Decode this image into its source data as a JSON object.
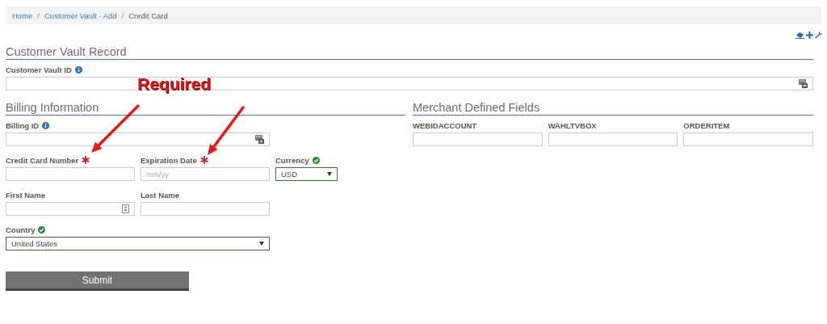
{
  "breadcrumb": [
    {
      "label": "Home",
      "current": false
    },
    {
      "separator": "/",
      "label": "Customer Vault - Add",
      "current": false
    },
    {
      "separator": "/",
      "label": "Credit Card",
      "current": true
    }
  ],
  "sections": [
    {
      "title": "Customer Vault Record",
      "rows": [
        [
          {
            "label": "Customer Vault ID",
            "kind": "text",
            "help": true,
            "lookup": true
          }
        ]
      ]
    },
    {
      "title": "Billing Information",
      "rows": [
        [
          {
            "label": "Billing ID",
            "kind": "text",
            "help": true,
            "lookup": true
          }
        ],
        [
          {
            "label": "Credit Card Number",
            "kind": "text",
            "required": true
          },
          {
            "label": "Expiration Date",
            "kind": "text",
            "required": true,
            "placeholder": "mm/yy"
          },
          {
            "label": "Currency",
            "kind": "select",
            "validated": true,
            "value": "USD"
          }
        ],
        [
          {
            "label": "First Name",
            "kind": "text",
            "contact_card": true
          },
          {
            "label": "Last Name",
            "kind": "text"
          }
        ],
        [
          {
            "label": "Country",
            "kind": "select",
            "validated": true,
            "value": "United States"
          }
        ]
      ]
    },
    {
      "title": "Merchant Defined Fields",
      "rows": [
        [
          {
            "label": "WEBIDACCOUNT",
            "kind": "text"
          },
          {
            "label": "WAHLTVBOX",
            "kind": "text"
          },
          {
            "label": "ORDERITEM",
            "kind": "text"
          }
        ]
      ]
    }
  ],
  "submit": {
    "label": "Submit"
  },
  "annotation": {
    "text": "Required"
  }
}
